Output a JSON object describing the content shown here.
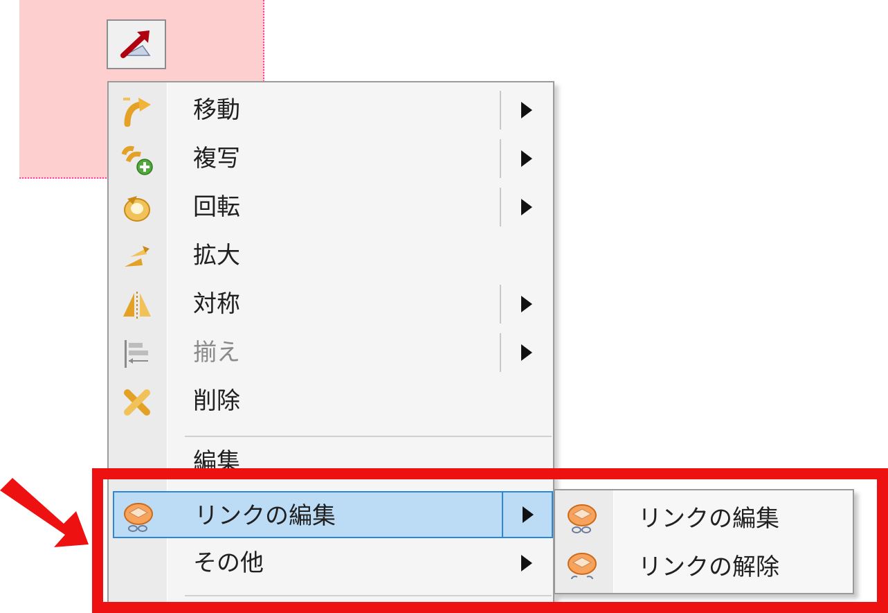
{
  "colors": {
    "canvas_pink": "#fdd0cf",
    "highlight_bg": "#bcdcf6",
    "highlight_border": "#2c87d6",
    "annotation_red": "#ee1111"
  },
  "toolbar": {
    "button_icon": "move-arrow-icon"
  },
  "context_menu": {
    "items": [
      {
        "label": "移動",
        "icon": "move-icon",
        "has_submenu": true
      },
      {
        "label": "複写",
        "icon": "copy-icon",
        "has_submenu": true
      },
      {
        "label": "回転",
        "icon": "rotate-icon",
        "has_submenu": true
      },
      {
        "label": "拡大",
        "icon": "scale-icon",
        "has_submenu": false
      },
      {
        "label": "対称",
        "icon": "mirror-icon",
        "has_submenu": true
      },
      {
        "label": "揃え",
        "icon": "align-icon",
        "has_submenu": true,
        "disabled": true
      },
      {
        "label": "削除",
        "icon": "delete-icon",
        "has_submenu": false
      },
      {
        "label": "編集",
        "icon": "",
        "has_submenu": false
      },
      {
        "label": "リンクの編集",
        "icon": "link-edit-icon",
        "has_submenu": true,
        "highlighted": true
      },
      {
        "label": "その他",
        "icon": "",
        "has_submenu": true
      }
    ]
  },
  "submenu": {
    "items": [
      {
        "label": "リンクの編集",
        "icon": "link-edit-icon"
      },
      {
        "label": "リンクの解除",
        "icon": "link-unlink-icon"
      }
    ]
  }
}
